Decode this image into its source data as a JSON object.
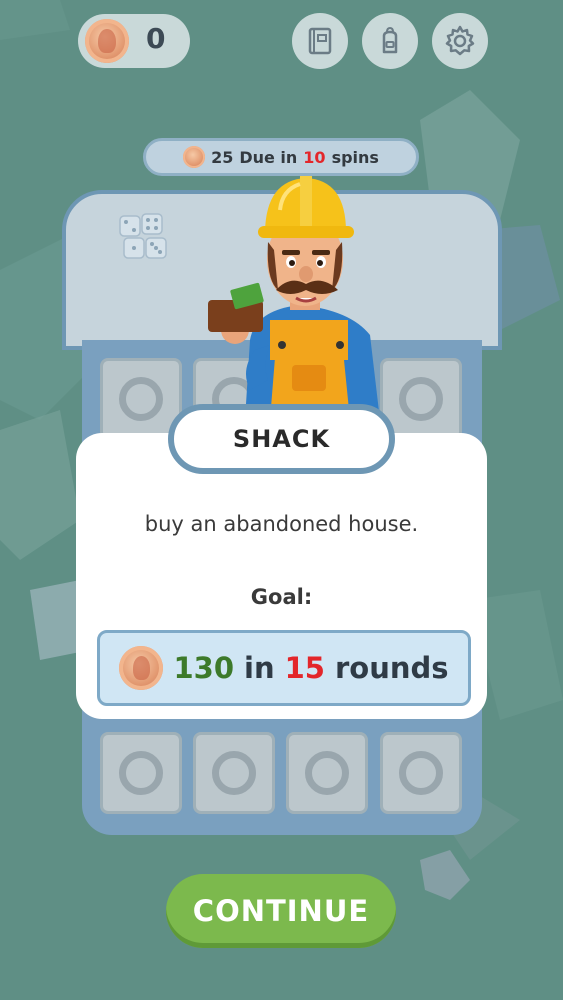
{
  "hud": {
    "coin_count": "0",
    "icons": [
      "coin-icon",
      "book-icon",
      "backpack-icon",
      "gear-icon"
    ]
  },
  "due": {
    "amount": "25",
    "text_mid": "Due in",
    "spins": "10",
    "text_end": "spins"
  },
  "dialog": {
    "title": "SHACK",
    "description": "buy an abandoned house.",
    "goal_label": "Goal:",
    "goal": {
      "amount": "130",
      "text_in": "in",
      "rounds": "15",
      "text_end": "rounds"
    }
  },
  "continue_label": "CONTINUE",
  "colors": {
    "background": "#5f8f85",
    "accent_blue": "#6e97b4",
    "button_green": "#7cb94d",
    "goal_amount": "#3d7a2a",
    "highlight_red": "#e3262a"
  }
}
